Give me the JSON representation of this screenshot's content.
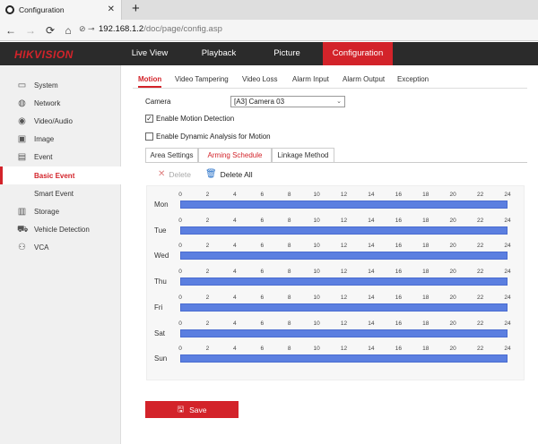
{
  "browser": {
    "tab_title": "Configuration",
    "url_host": "192.168.1.2",
    "url_path": "/doc/page/config.asp",
    "new_tab": "+",
    "close": "✕"
  },
  "brand": {
    "logo": "HIKVISION",
    "accent": "#d3232a"
  },
  "topnav": [
    {
      "label": "Live View"
    },
    {
      "label": "Playback"
    },
    {
      "label": "Picture"
    },
    {
      "label": "Configuration",
      "active": true
    }
  ],
  "sidebar": [
    {
      "label": "System",
      "icon": "monitor-icon"
    },
    {
      "label": "Network",
      "icon": "globe-icon"
    },
    {
      "label": "Video/Audio",
      "icon": "video-icon"
    },
    {
      "label": "Image",
      "icon": "image-icon"
    },
    {
      "label": "Event",
      "icon": "calendar-icon"
    },
    {
      "label": "Basic Event",
      "active": true
    },
    {
      "label": "Smart Event"
    },
    {
      "label": "Storage",
      "icon": "storage-icon"
    },
    {
      "label": "Vehicle Detection",
      "icon": "car-icon"
    },
    {
      "label": "VCA",
      "icon": "vca-icon"
    }
  ],
  "subtabs": [
    {
      "label": "Motion",
      "active": true
    },
    {
      "label": "Video Tampering"
    },
    {
      "label": "Video Loss"
    },
    {
      "label": "Alarm Input"
    },
    {
      "label": "Alarm Output"
    },
    {
      "label": "Exception"
    }
  ],
  "camera": {
    "label": "Camera",
    "value": "[A3] Camera 03"
  },
  "options": {
    "enable_motion": {
      "label": "Enable Motion Detection",
      "checked": true
    },
    "enable_dynamic": {
      "label": "Enable Dynamic Analysis for Motion",
      "checked": false
    }
  },
  "panel_tabs": [
    {
      "label": "Area Settings"
    },
    {
      "label": "Arming Schedule",
      "active": true
    },
    {
      "label": "Linkage Method"
    }
  ],
  "toolbar": {
    "delete_label": "Delete",
    "delete_all_label": "Delete All"
  },
  "schedule": {
    "hours": [
      "0",
      "2",
      "4",
      "6",
      "8",
      "10",
      "12",
      "14",
      "16",
      "18",
      "20",
      "22",
      "24"
    ],
    "days": [
      "Mon",
      "Tue",
      "Wed",
      "Thu",
      "Fri",
      "Sat",
      "Sun"
    ],
    "bar_color": "#5b7fe0",
    "armed_range": "0-24 every day"
  },
  "save_label": "Save"
}
